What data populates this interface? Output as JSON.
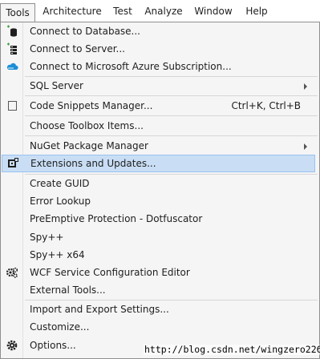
{
  "menubar": {
    "items": [
      {
        "label": "Tools",
        "active": true
      },
      {
        "label": "Architecture"
      },
      {
        "label": "Test"
      },
      {
        "label": "Analyze"
      },
      {
        "label": "Window"
      },
      {
        "label": "Help"
      }
    ]
  },
  "menu": {
    "items": [
      {
        "label": "Connect to Database...",
        "icon": "connect-database-icon"
      },
      {
        "label": "Connect to Server...",
        "icon": "connect-server-icon"
      },
      {
        "label": "Connect to Microsoft Azure Subscription...",
        "icon": "azure-cloud-icon"
      },
      {
        "label": "SQL Server",
        "submenu": true
      },
      {
        "label": "Code Snippets Manager...",
        "shortcut": "Ctrl+K, Ctrl+B",
        "icon": "checkbox-icon"
      },
      {
        "label": "Choose Toolbox Items..."
      },
      {
        "label": "NuGet Package Manager",
        "submenu": true
      },
      {
        "label": "Extensions and Updates...",
        "icon": "extensions-icon",
        "highlighted": true
      },
      {
        "label": "Create GUID"
      },
      {
        "label": "Error Lookup"
      },
      {
        "label": "PreEmptive Protection - Dotfuscator"
      },
      {
        "label": "Spy++"
      },
      {
        "label": "Spy++ x64"
      },
      {
        "label": "WCF Service Configuration Editor",
        "icon": "gears-icon"
      },
      {
        "label": "External Tools..."
      },
      {
        "label": "Import and Export Settings..."
      },
      {
        "label": "Customize..."
      },
      {
        "label": "Options...",
        "icon": "gear-icon"
      }
    ]
  },
  "watermark": "http://blog.csdn.net/wingzero226",
  "colors": {
    "menu_background": "#f5f5f5",
    "highlight_fill": "#c9def5",
    "highlight_border": "#99c2ef",
    "border": "#8f8f8f"
  }
}
